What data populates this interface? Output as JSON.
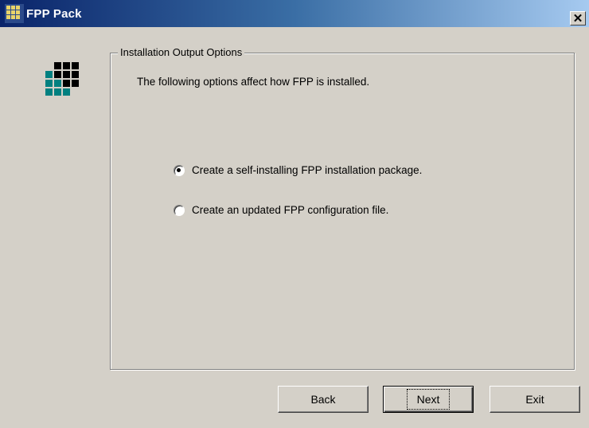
{
  "window": {
    "title": "FPP Pack",
    "close_glyph": "✕",
    "title_gradient": [
      "#0a246a",
      "#a6caf0"
    ]
  },
  "group": {
    "label": "Installation Output Options",
    "description": "The following options affect how FPP is installed."
  },
  "options": [
    {
      "label": "Create a self-installing FPP installation package.",
      "checked": true
    },
    {
      "label": "Create an updated FPP configuration file.",
      "checked": false
    }
  ],
  "buttons": {
    "back": "Back",
    "next": "Next",
    "exit": "Exit"
  },
  "logo": {
    "colors": {
      "dark": "#000000",
      "teal": "#008080"
    }
  }
}
